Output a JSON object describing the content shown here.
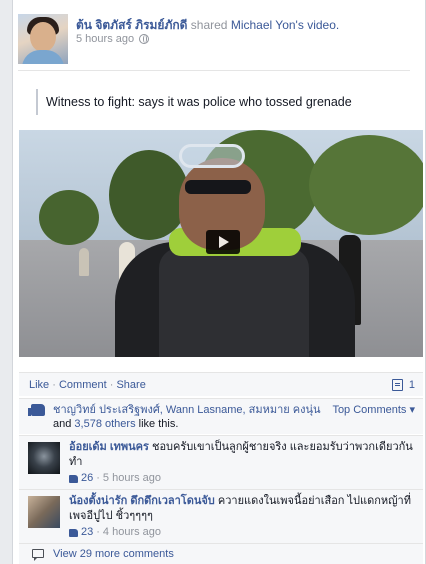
{
  "post": {
    "author": "ต้น จิตภัสร์ ภิรมย์ภักดี",
    "action": "shared",
    "shared_from": "Michael Yon's",
    "object": "video.",
    "time": "5 hours ago",
    "privacy_icon": "globe-icon",
    "quote": "Witness to fight: says it was police who tossed grenade"
  },
  "video": {
    "play_icon": "play-icon"
  },
  "actions": {
    "like": "Like",
    "comment": "Comment",
    "share": "Share",
    "separator": "·",
    "share_count": "1"
  },
  "likes": {
    "names": "ชาญวิทย์ ประเสริฐพงศ์, Wann Lasname, สมหมาย คงนุ่น",
    "and": "and",
    "others": "3,578 others",
    "suffix": "like this.",
    "sort_label": "Top Comments ▾"
  },
  "comments": [
    {
      "name": "อ้อยเด้ม เทพนคร",
      "text": "ชอบครับเขาเป็นลูกผู้ชายจริง และยอมรับว่าพวกเดียวกันทำ",
      "likes": "26",
      "time": "5 hours ago"
    },
    {
      "name": "น้องตั้งน่ารัก ดึกดึกเวลาโดนจับ",
      "text": "ควายแดงในเพจนี้อย่าเสือก ไปแดกหญ้าที่เพจอีปูไป ชิ้วๆๆๆๆ",
      "likes": "23",
      "time": "4 hours ago"
    }
  ],
  "view_more": "View 29 more comments"
}
